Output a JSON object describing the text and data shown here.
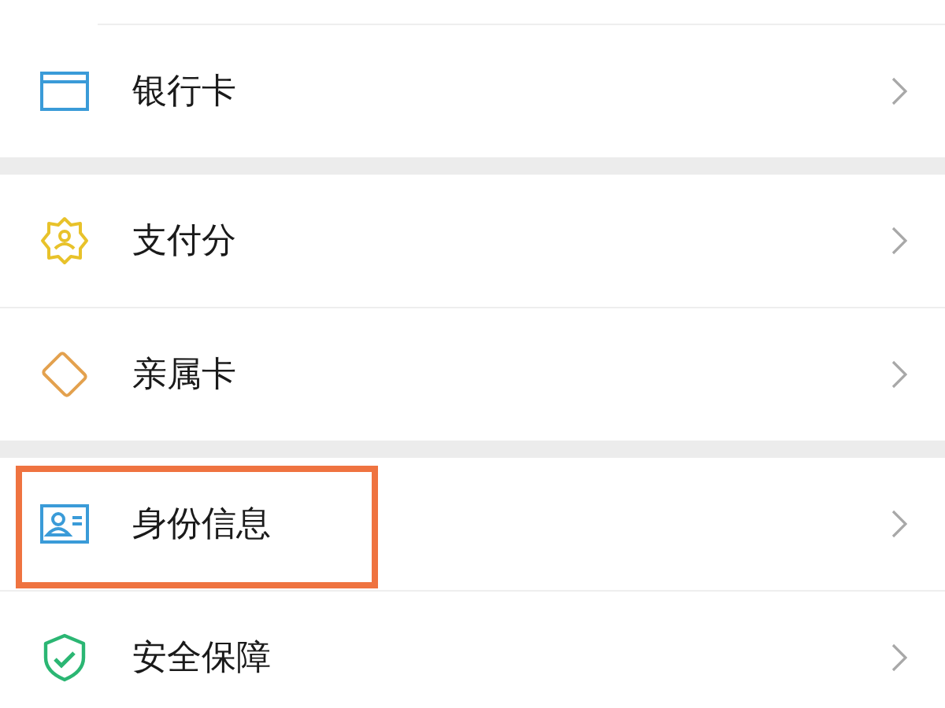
{
  "groups": [
    {
      "items": [
        {
          "label": "银行卡",
          "highlighted": false
        }
      ]
    },
    {
      "items": [
        {
          "label": "支付分",
          "highlighted": false
        },
        {
          "label": "亲属卡",
          "highlighted": false
        }
      ]
    },
    {
      "items": [
        {
          "label": "身份信息",
          "highlighted": true
        },
        {
          "label": "安全保障",
          "highlighted": false
        }
      ]
    }
  ]
}
